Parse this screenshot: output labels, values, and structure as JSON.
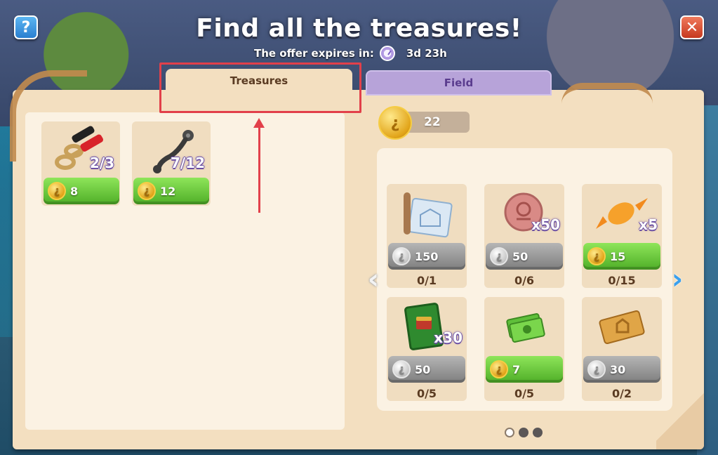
{
  "header": {
    "help_label": "?",
    "close_label": "✕",
    "title": "Find all the treasures!",
    "expires_label": "The offer expires in:",
    "expires_time": "3d 23h"
  },
  "tabs": [
    {
      "label": "Treasures",
      "selected": true
    },
    {
      "label": "Field",
      "selected": false
    }
  ],
  "treasures": [
    {
      "icon": "battery-clamp-icon",
      "count": "2/3",
      "price": "8"
    },
    {
      "icon": "wrench-arm-icon",
      "count": "7/12",
      "price": "12"
    }
  ],
  "balance": {
    "value": "22",
    "coin_symbol": "¿"
  },
  "shop": {
    "items": [
      {
        "icon": "blueprint-icon",
        "qty": "",
        "price": "150",
        "currency": "silver",
        "progress": "0/1"
      },
      {
        "icon": "copper-token-icon",
        "qty": "x50",
        "price": "50",
        "currency": "silver",
        "progress": "0/6"
      },
      {
        "icon": "candy-icon",
        "qty": "x5",
        "price": "15",
        "currency": "gold",
        "progress": "0/15"
      },
      {
        "icon": "green-book-icon",
        "qty": "x30",
        "price": "50",
        "currency": "silver",
        "progress": "0/5"
      },
      {
        "icon": "cash-icon",
        "qty": "",
        "price": "7",
        "currency": "gold",
        "progress": "0/5"
      },
      {
        "icon": "ticket-icon",
        "qty": "",
        "price": "30",
        "currency": "silver",
        "progress": "0/2"
      }
    ],
    "page": 1,
    "page_count": 3
  },
  "colors": {
    "parchment": "#f3dfc0",
    "highlight": "#e2404a",
    "green_button": "#4fae27",
    "gray_button": "#7e7e7e",
    "field_tab": "#b7a3d9"
  }
}
